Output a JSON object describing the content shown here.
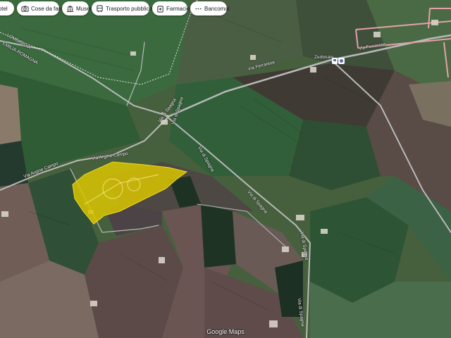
{
  "chips": [
    {
      "label": "Hotel",
      "icon": "bed-icon"
    },
    {
      "label": "Cose da fare",
      "icon": "camera-icon"
    },
    {
      "label": "Musei",
      "icon": "museum-icon"
    },
    {
      "label": "Trasporto pubblico",
      "icon": "bus-icon"
    },
    {
      "label": "Farmacie",
      "icon": "pharmacy-icon"
    },
    {
      "label": "Bancomat",
      "icon": "atm-icon"
    }
  ],
  "map_labels": {
    "lombardia": "LOMBARDIA",
    "emilia_romagna": "EMILIA-ROMAGNA",
    "via_ferrarese_left": "Via Ferrarese",
    "via_ferrarese_right": "Via Ferrarese",
    "zerbinate": "Zerbinate",
    "via_argine_campo_left": "Via Argine Campo",
    "via_argine_campo_mid": "Via Argine Campo",
    "via_di_spagna_1": "Via di Spagna",
    "via_di_spagna_2": "Via di Spagna",
    "via_di_spagna_3": "Via di Spagna",
    "via_di_spagna_4": "Via di Spagna",
    "via_di_spagna_5": "Via di Spagna"
  },
  "attribution": "Google Maps",
  "colors": {
    "highlight": "#d9c400",
    "road": "#b9b9b9",
    "boundary": "#ffffff",
    "selection_outline": "#e8a0a8"
  }
}
